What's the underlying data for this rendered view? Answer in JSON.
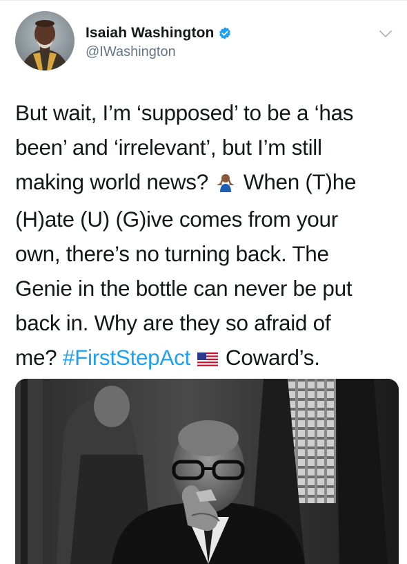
{
  "tweet": {
    "author": {
      "display_name": "Isaiah Washington",
      "handle": "@IWashington",
      "verified": true
    },
    "text_lines": [
      "But wait, I’m ‘supposed’ to be a ‘has",
      "been’ and ‘irrelevant’, but I’m still",
      "making world news?",
      "When (T)he",
      "(H)ate (U) (G)ive comes from your",
      "own, there’s no turning back. The",
      "Genie in the bottle can never be put",
      "back in. Why are they so afraid of",
      "me?",
      "#FirstStepAct",
      "Coward’s."
    ],
    "icons": {
      "verified": "verified-badge-icon",
      "menu": "chevron-down-icon",
      "shrug": "person-shrugging-emoji",
      "flag": "us-flag-emoji"
    },
    "colors": {
      "link": "#1da1f2",
      "handle": "#657786",
      "text": "#14171a"
    }
  }
}
